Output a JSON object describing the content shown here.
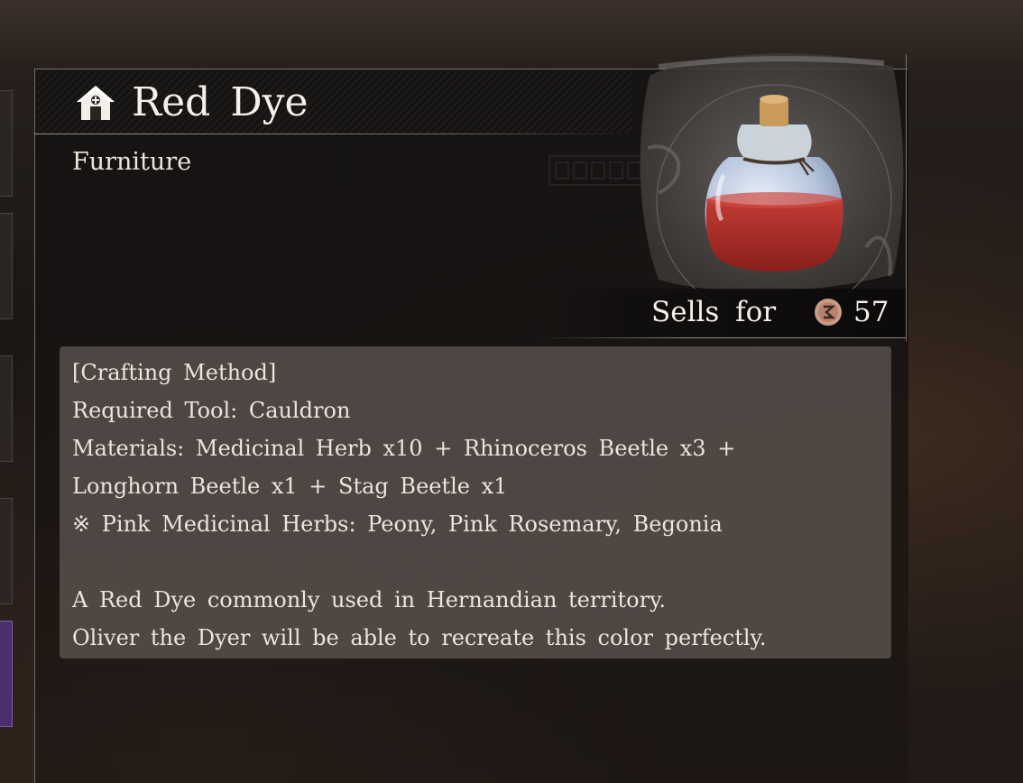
{
  "item": {
    "name": "Red Dye",
    "category": "Furniture",
    "category_icon": "house-icon",
    "image": "red-dye-potion-bottle"
  },
  "sell": {
    "label": "Sells for",
    "currency_icon": "coin-icon",
    "value": "57"
  },
  "description": {
    "lines": [
      "[Crafting Method]",
      "Required Tool: Cauldron",
      "Materials: Medicinal Herb x10 + Rhinoceros Beetle x3 +",
      "Longhorn Beetle x1 + Stag Beetle x1",
      "※ Pink Medicinal Herbs: Peony, Pink Rosemary, Begonia",
      "",
      "A Red Dye commonly used in Hernandian territory.",
      "Oliver the Dyer will be able to recreate this color perfectly."
    ]
  },
  "colors": {
    "text": "#f4f0ea",
    "panel": "#161312",
    "desc_box": "#5c5450",
    "dye": "#b3312c"
  }
}
